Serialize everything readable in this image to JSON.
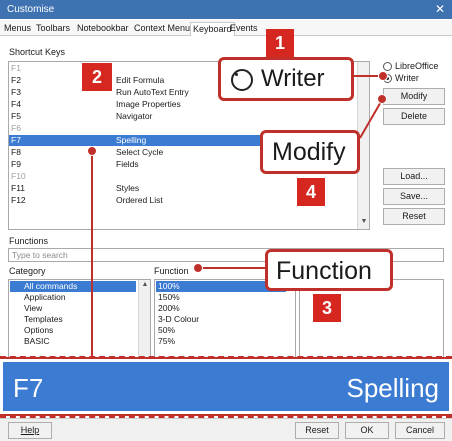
{
  "window": {
    "title": "Customise",
    "close_glyph": "✕"
  },
  "tabs": [
    "Menus",
    "Toolbars",
    "Notebookbar",
    "Context Menus",
    "Keyboard",
    "Events"
  ],
  "shortcut_keys": {
    "label": "Shortcut Keys",
    "rows": [
      {
        "key": "F1",
        "function": ""
      },
      {
        "key": "F2",
        "function": "Edit Formula"
      },
      {
        "key": "F3",
        "function": "Run AutoText Entry"
      },
      {
        "key": "F4",
        "function": "Image Properties"
      },
      {
        "key": "F5",
        "function": "Navigator"
      },
      {
        "key": "F6",
        "function": ""
      },
      {
        "key": "F7",
        "function": "Spelling"
      },
      {
        "key": "F8",
        "function": "Select Cycle"
      },
      {
        "key": "F9",
        "function": "Fields"
      },
      {
        "key": "F10",
        "function": ""
      },
      {
        "key": "F11",
        "function": "Styles"
      },
      {
        "key": "F12",
        "function": "Ordered List"
      }
    ],
    "selected_index": 6
  },
  "scope": {
    "libreoffice": "LibreOffice",
    "writer": "Writer"
  },
  "buttons": {
    "modify": "Modify",
    "delete": "Delete",
    "load": "Load...",
    "save": "Save...",
    "reset": "Reset"
  },
  "functions": {
    "label": "Functions",
    "search_placeholder": "Type to search",
    "category_label": "Category",
    "function_label": "Function",
    "categories": [
      "All commands",
      "Application",
      "View",
      "Templates",
      "Options",
      "BASIC"
    ],
    "category_selected_index": 0,
    "function_items": [
      "100%",
      "150%",
      "200%",
      "3-D Colour",
      "50%",
      "75%"
    ],
    "function_selected_index": 0
  },
  "callouts": {
    "writer": {
      "number": "1",
      "text": "Writer"
    },
    "shortcut": {
      "number": "2"
    },
    "function": {
      "number": "3",
      "text": "Function"
    },
    "modify": {
      "number": "4",
      "text": "Modify"
    },
    "zoom": {
      "key": "F7",
      "function": "Spelling"
    }
  },
  "bottom": {
    "help": "Help",
    "reset": "Reset",
    "ok": "OK",
    "cancel": "Cancel"
  },
  "colors": {
    "title_bar": "#3e72b0",
    "selection": "#3b7bd1",
    "callout_red": "#c0302a",
    "badge_red": "#d5261f"
  }
}
